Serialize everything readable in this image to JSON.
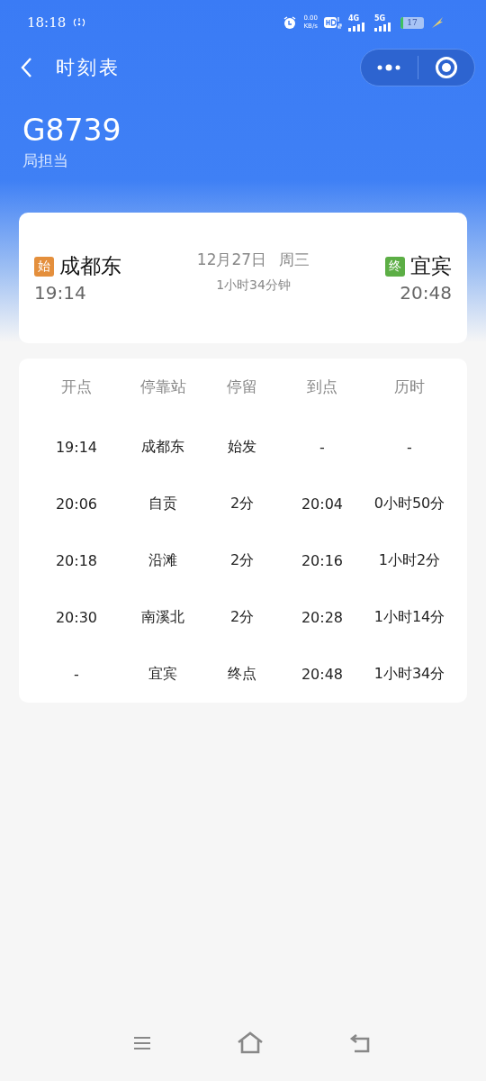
{
  "status_bar": {
    "time": "18:18",
    "net_speed": "0.00",
    "net_unit": "KB/s",
    "network_1": "4G",
    "network_2": "5G",
    "battery": "17"
  },
  "nav": {
    "title": "时刻表"
  },
  "train": {
    "number": "G8739",
    "operator": "局担当"
  },
  "journey": {
    "from": {
      "badge": "始",
      "station": "成都东",
      "time": "19:14"
    },
    "date": "12月27日",
    "weekday": "周三",
    "duration": "1小时34分钟",
    "to": {
      "badge": "终",
      "station": "宜宾",
      "time": "20:48"
    }
  },
  "table": {
    "columns": [
      "开点",
      "停靠站",
      "停留",
      "到点",
      "历时"
    ],
    "rows": [
      [
        "19:14",
        "成都东",
        "始发",
        "-",
        "-"
      ],
      [
        "20:06",
        "自贡",
        "2分",
        "20:04",
        "0小时50分"
      ],
      [
        "20:18",
        "沿滩",
        "2分",
        "20:16",
        "1小时2分"
      ],
      [
        "20:30",
        "南溪北",
        "2分",
        "20:28",
        "1小时14分"
      ],
      [
        "-",
        "宜宾",
        "终点",
        "20:48",
        "1小时34分"
      ]
    ]
  }
}
